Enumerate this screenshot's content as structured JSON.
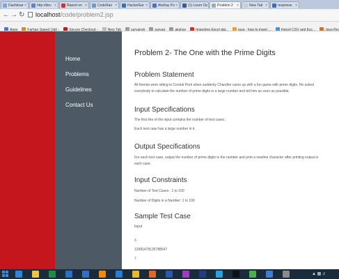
{
  "browser": {
    "tabs": [
      {
        "label": "Dashboar",
        "icon": "doc-icon",
        "color": "#7aa7d6"
      },
      {
        "label": "http://dev",
        "icon": "doc-icon",
        "color": "#5a86c5"
      },
      {
        "label": "Report on",
        "icon": "gmail-icon",
        "color": "#d93025"
      },
      {
        "label": "CodeRan",
        "icon": "doc-icon",
        "color": "#6c9bd1"
      },
      {
        "label": "HackerEar",
        "icon": "doc-icon",
        "color": "#3a6fb5"
      },
      {
        "label": "Akshay Po",
        "icon": "doc-icon",
        "color": "#4c74b8"
      },
      {
        "label": "(1) Learn Co",
        "icon": "facebook-icon",
        "color": "#3b5998"
      },
      {
        "label": "Problem 2",
        "icon": "doc-icon",
        "color": "#9aa9c0",
        "active": true
      },
      {
        "label": "New Tab",
        "icon": "doc-icon",
        "color": "#cccccc"
      },
      {
        "label": "response",
        "icon": "doc-icon",
        "color": "#3a6fb5"
      }
    ],
    "url_host": "localhost",
    "url_path": "/code/problem2.jsp",
    "bookmarks": [
      {
        "label": "Apps",
        "color": "#4a79c8"
      },
      {
        "label": "Farhan Saeed (Jal) -",
        "color": "#e08a1e"
      },
      {
        "label": "Secure Checkout -",
        "color": "#c4161c"
      },
      {
        "label": "New Tab",
        "color": "#bbbbbb"
      },
      {
        "label": "suryansh",
        "color": "#999999"
      },
      {
        "label": "suryan",
        "color": "#999999"
      },
      {
        "label": "akshay",
        "color": "#999999"
      },
      {
        "label": "Importing Excel dat...",
        "color": "#d93025"
      },
      {
        "label": "java - how to insert ...",
        "color": "#f0a020"
      },
      {
        "label": "Import CSV and Exc...",
        "color": "#4a90d9"
      },
      {
        "label": "Java Reveals",
        "color": "#e07020"
      }
    ]
  },
  "sidebar": {
    "items": [
      "Home",
      "Problems",
      "Guidelines",
      "Contact Us"
    ],
    "bg": "#4d5a66"
  },
  "main": {
    "title": "Problem 2- The One with the Prime Digits",
    "statement_heading": "Problem Statement",
    "statement_line1": "All friends were sitting in Central Perk when suddenly Chandler came up with a fun game with prime digits. He asked",
    "statement_line2": "everybody to calculate the number of prime digits in a large number and tell him as soon as possible.",
    "input_heading": "Input Specifications",
    "input_line1": "The first line of the input contains the number of test cases.",
    "input_line2": "Each test case has a large number in it.",
    "output_heading": "Output Specifications",
    "output_line1": "For each test case, output the number of prime digits in the number and print a newline character after printing output in",
    "output_line2": "each case.",
    "constraints_heading": "Input Constraints",
    "constraint1": "Number of Test Cases : 1 to 100",
    "constraint2": "Number of Digits in a Number: 1 to 100",
    "sample_heading": "Sample Test Case",
    "input_label": "Input",
    "sample_line1": "3",
    "sample_line2": "12981478135788547",
    "sample_line3": "7"
  },
  "taskbar": {
    "icons": [
      {
        "name": "ie-icon",
        "color": "#2f86d8"
      },
      {
        "name": "folder-icon",
        "color": "#f2c14a"
      },
      {
        "name": "excel-icon",
        "color": "#1f8a4c"
      },
      {
        "name": "outlook-icon",
        "color": "#2b6fc4"
      },
      {
        "name": "app-icon",
        "color": "#3570c0"
      },
      {
        "name": "vlc-icon",
        "color": "#f08a10"
      },
      {
        "name": "store-icon",
        "color": "#2a7bd4"
      },
      {
        "name": "chrome-icon",
        "color": "#e8b830"
      },
      {
        "name": "firefox-icon",
        "color": "#e0662a"
      },
      {
        "name": "word-icon",
        "color": "#2a5aa8"
      },
      {
        "name": "app2-icon",
        "color": "#9b3fc0"
      },
      {
        "name": "photoshop-icon",
        "color": "#1f3f7a"
      },
      {
        "name": "app3-icon",
        "color": "#2aa1d8"
      },
      {
        "name": "terminal-icon",
        "color": "#111111"
      },
      {
        "name": "app4-icon",
        "color": "#4cae4c"
      },
      {
        "name": "app5-icon",
        "color": "#3e7fd0"
      },
      {
        "name": "app6-icon",
        "color": "#8a8a8a"
      }
    ]
  }
}
